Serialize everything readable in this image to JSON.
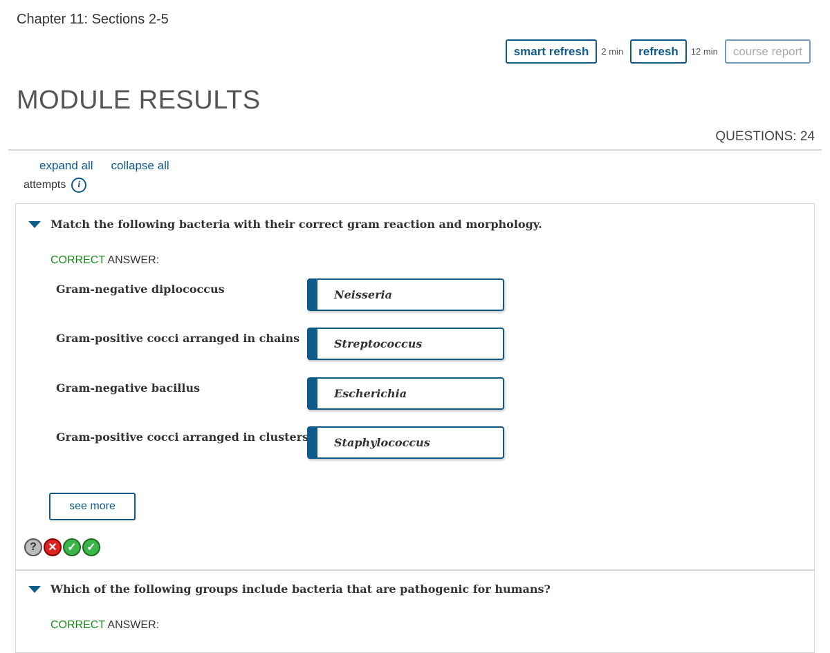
{
  "header": {
    "chapter_title": "Chapter 11: Sections 2-5",
    "module_title": "MODULE RESULTS",
    "questions_label": "QUESTIONS: 24"
  },
  "toolbar": {
    "smart_refresh_label": "smart refresh",
    "smart_refresh_time": "2 min",
    "refresh_label": "refresh",
    "refresh_time": "12 min",
    "course_report_label": "course report"
  },
  "controls": {
    "expand_all": "expand all",
    "collapse_all": "collapse all",
    "attempts_label": "attempts",
    "info_icon_glyph": "i"
  },
  "questions": [
    {
      "text": "Match the following bacteria with their correct gram reaction and morphology.",
      "correct_word": "CORRECT",
      "answer_word": " ANSWER:",
      "matches": [
        {
          "label": "Gram-negative diplococcus",
          "answer": "Neisseria"
        },
        {
          "label": "Gram-positive cocci arranged in chains",
          "answer": "Streptococcus"
        },
        {
          "label": "Gram-negative bacillus",
          "answer": "Escherichia"
        },
        {
          "label": "Gram-positive cocci arranged in clusters",
          "answer": "Staphylococcus"
        }
      ],
      "see_more_label": "see more",
      "attempts": [
        "unknown",
        "wrong",
        "right",
        "right"
      ],
      "attempt_glyphs": {
        "unknown": "?",
        "wrong": "✕",
        "right": "✓"
      }
    },
    {
      "text": "Which of the following groups include bacteria that are pathogenic for humans?",
      "correct_word": "CORRECT",
      "answer_word": " ANSWER:"
    }
  ],
  "colors": {
    "accent": "#0e5a8a",
    "correct_green": "#1a8a1a",
    "attempt_wrong": "#dd2222",
    "attempt_right": "#3cb54a"
  }
}
